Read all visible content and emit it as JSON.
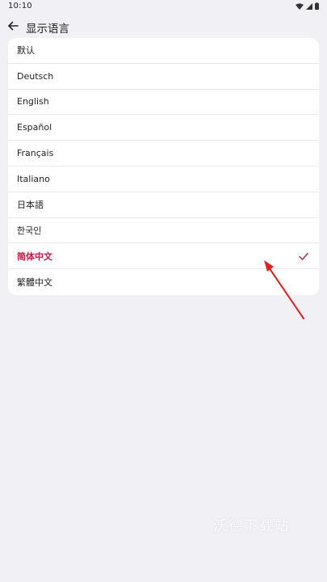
{
  "status_bar": {
    "time": "10:10",
    "icons": [
      "wifi-icon",
      "signal-icon",
      "battery-icon"
    ]
  },
  "app_bar": {
    "back_icon": "arrow-left-icon",
    "title": "显示语言"
  },
  "languages": {
    "items": [
      {
        "label": "默认"
      },
      {
        "label": "Deutsch"
      },
      {
        "label": "English"
      },
      {
        "label": "Español"
      },
      {
        "label": "Français"
      },
      {
        "label": "Italiano"
      },
      {
        "label": "日本語"
      },
      {
        "label": "한국인"
      },
      {
        "label": "简体中文"
      },
      {
        "label": "繁體中文"
      }
    ],
    "selected_index": 8,
    "selected_icon": "check-icon"
  },
  "colors": {
    "accent": "#c41b45",
    "background": "#f1f0f5",
    "card": "#ffffff",
    "annotation_arrow": "#e02020"
  },
  "watermark": {
    "text": "沃德下载站"
  }
}
